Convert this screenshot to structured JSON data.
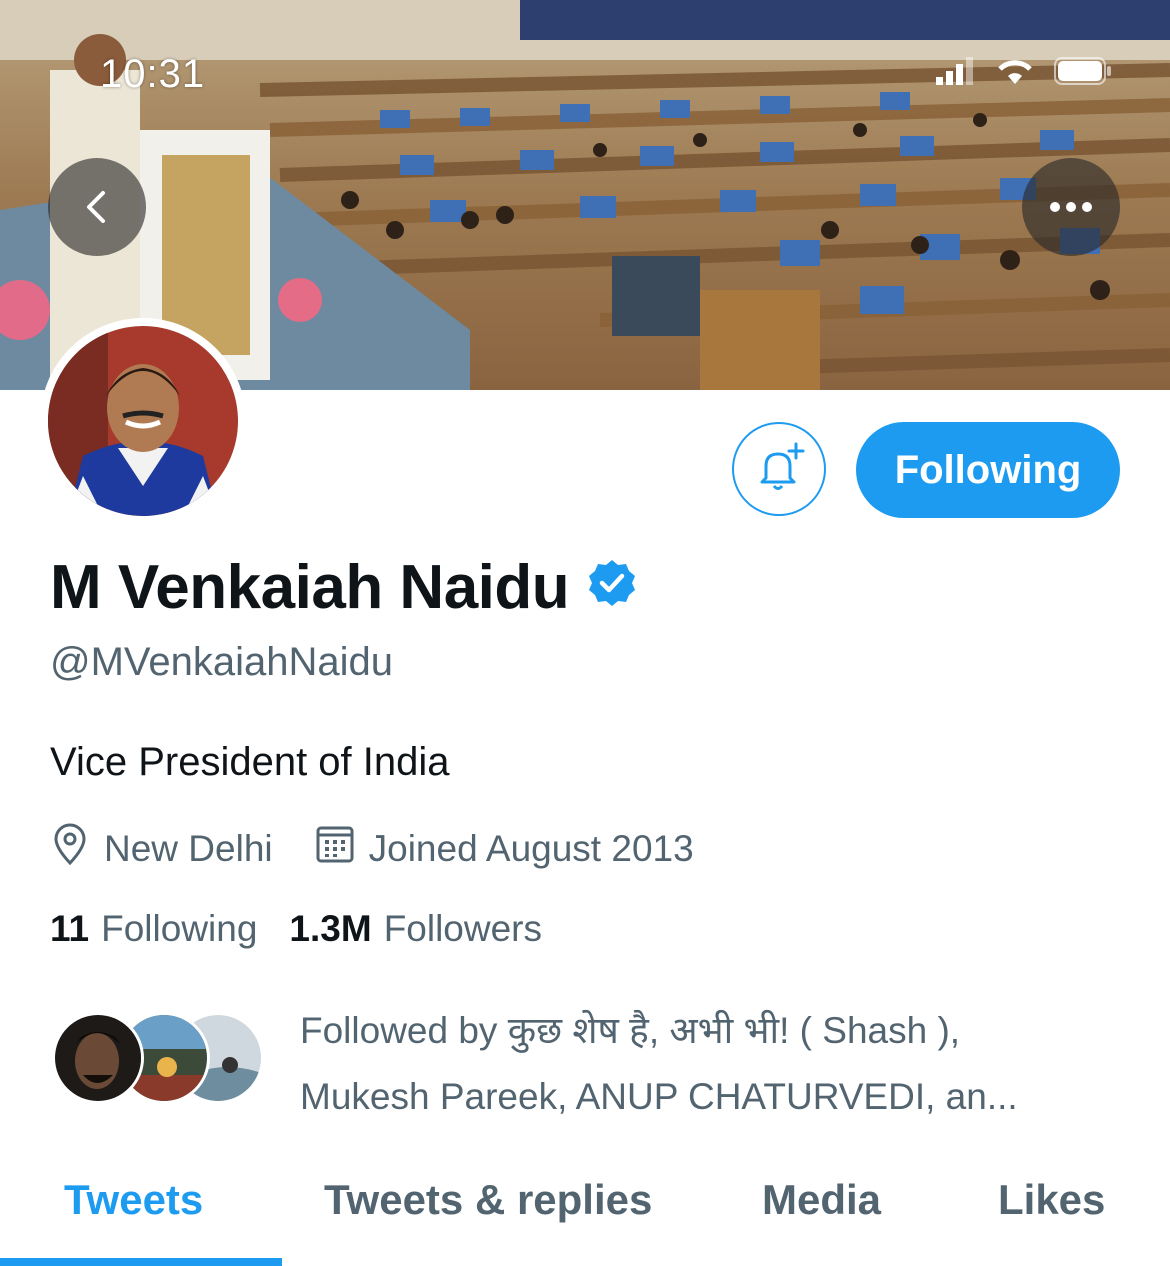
{
  "status_bar": {
    "time": "10:31"
  },
  "profile": {
    "display_name": "M Venkaiah Naidu",
    "handle": "@MVenkaiahNaidu",
    "bio": "Vice President of India",
    "location": "New Delhi",
    "joined": "Joined August 2013",
    "following_count": "11",
    "following_label": "Following",
    "followers_count": "1.3M",
    "followers_label": "Followers",
    "verified": true
  },
  "actions": {
    "following_button": "Following"
  },
  "followed_by": {
    "line1": "Followed by कुछ शेष है, अभी भी! ( Shash ),",
    "line2": "Mukesh Pareek, ANUP CHATURVEDI, an..."
  },
  "tabs": [
    {
      "label": "Tweets",
      "active": true
    },
    {
      "label": "Tweets & replies",
      "active": false
    },
    {
      "label": "Media",
      "active": false
    },
    {
      "label": "Likes",
      "active": false
    }
  ],
  "colors": {
    "accent": "#1d9bf0",
    "secondary_text": "#536471",
    "primary_text": "#0f1419"
  },
  "icons": [
    "back-arrow-icon",
    "more-options-icon",
    "bell-plus-icon",
    "verified-badge-icon",
    "location-pin-icon",
    "calendar-icon",
    "signal-icon",
    "wifi-icon",
    "battery-icon"
  ]
}
